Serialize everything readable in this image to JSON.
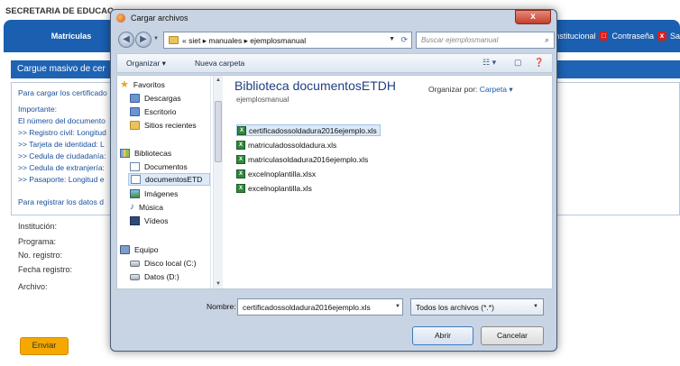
{
  "page": {
    "app_title": "SECRETARIA DE EDUCAC",
    "nav": {
      "main_label": "Matrículas",
      "institucional": "nstitucional",
      "contrasena": "Contraseña",
      "sa": "Sa"
    },
    "section_title": "Cargue masivo de cer",
    "info_lines": [
      "Para cargar los certificado",
      "Importante:",
      "El número del documento",
      ">> Registro civil: Longitud",
      ">> Tarjeta de identidad: L",
      ">> Cedula de ciudadanía:",
      ">> Cedula de extranjería:",
      ">> Pasaporte: Longitud e",
      "Para registrar los datos d"
    ],
    "form_labels": [
      "Institución:",
      "Programa:",
      "No. registro:",
      "Fecha registro:",
      "Archivo:"
    ],
    "enviar_label": "Enviar"
  },
  "dialog": {
    "title": "Cargar archivos",
    "breadcrumb": [
      "«",
      "siet",
      "▸",
      "manuales",
      "▸",
      "ejemplosmanual"
    ],
    "search_placeholder": "Buscar ejemplosmanual",
    "toolbar": {
      "organize": "Organizar ▾",
      "new_folder": "Nueva carpeta"
    },
    "nav_items": [
      {
        "label": "Favoritos",
        "icon": "star-icon",
        "indent": 0
      },
      {
        "label": "Descargas",
        "icon": "downloads-folder-icon",
        "indent": 1
      },
      {
        "label": "Escritorio",
        "icon": "desktop-icon",
        "indent": 1
      },
      {
        "label": "Sitios recientes",
        "icon": "recent-places-icon",
        "indent": 1
      },
      {
        "label": "Bibliotecas",
        "icon": "libraries-icon",
        "indent": 0
      },
      {
        "label": "Documentos",
        "icon": "documents-icon",
        "indent": 1
      },
      {
        "label": "documentosETD",
        "icon": "library-folder-icon",
        "indent": 1,
        "selected": true
      },
      {
        "label": "Imágenes",
        "icon": "pictures-icon",
        "indent": 1
      },
      {
        "label": "Música",
        "icon": "music-icon",
        "indent": 1
      },
      {
        "label": "Vídeos",
        "icon": "videos-icon",
        "indent": 1
      },
      {
        "label": "Equipo",
        "icon": "computer-icon",
        "indent": 0
      },
      {
        "label": "Disco local (C:)",
        "icon": "drive-c-icon",
        "indent": 1
      },
      {
        "label": "Datos (D:)",
        "icon": "drive-d-icon",
        "indent": 1
      }
    ],
    "library_title": "Biblioteca documentosETDH",
    "library_subtitle": "ejemplosmanual",
    "arrange_label": "Organizar por:",
    "arrange_value": "Carpeta ▾",
    "files": [
      {
        "name": "certificadossoldadura2016ejemplo.xls",
        "selected": true
      },
      {
        "name": "matriculadossoldadura.xls"
      },
      {
        "name": "matriculasoldadura2016ejemplo.xls"
      },
      {
        "name": "excelnoplantilla.xlsx"
      },
      {
        "name": "excelnoplantilla.xls"
      }
    ],
    "filename_label": "Nombre:",
    "filename_value": "certificadossoldadura2016ejemplo.xls",
    "filetype_value": "Todos los archivos (*.*)",
    "open_label": "Abrir",
    "cancel_label": "Cancelar",
    "close_label": "x"
  },
  "colors": {
    "nav_blue": "#1a5fb0",
    "section_blue": "#1e63b4",
    "enviar_orange": "#f5a800",
    "dialog_frame": "#c8d4e3",
    "selection": "#dceaf9"
  }
}
